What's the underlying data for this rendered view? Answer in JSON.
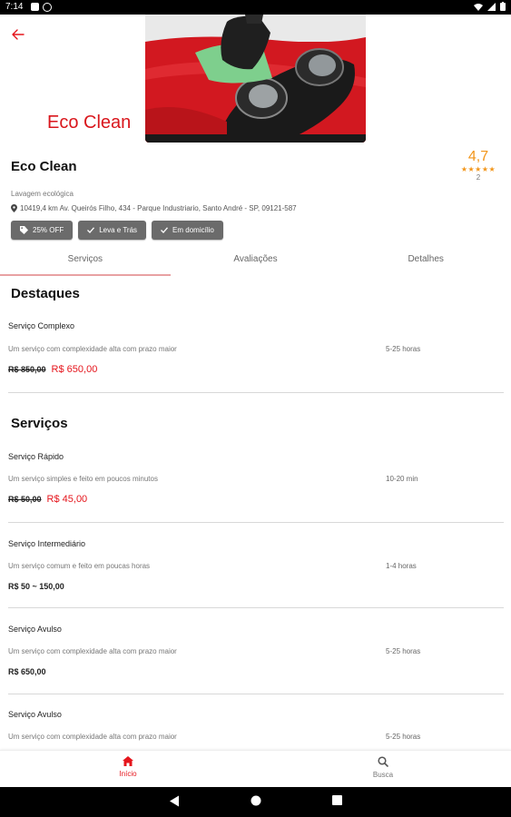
{
  "status_bar": {
    "time": "7:14"
  },
  "shop": {
    "hero_logo_text": "Eco Clean",
    "name": "Eco Clean",
    "rating": "4,7",
    "stars": "★★★★★",
    "review_count": "2",
    "category": "Lavagem ecológica",
    "address": "10419,4 km Av. Queirós Filho, 434 - Parque Industriario, Santo André - SP, 09121-587"
  },
  "badges": [
    {
      "label": "25% OFF",
      "icon": "tag-icon"
    },
    {
      "label": "Leva e Trás",
      "icon": "check-icon"
    },
    {
      "label": "Em domicílio",
      "icon": "check-icon"
    }
  ],
  "tabs": [
    {
      "label": "Serviços",
      "active": true
    },
    {
      "label": "Avaliações",
      "active": false
    },
    {
      "label": "Detalhes",
      "active": false
    }
  ],
  "highlights": {
    "title": "Destaques",
    "items": [
      {
        "name": "Serviço Complexo",
        "description": "Um serviço com complexidade alta com prazo maior",
        "duration": "5-25 horas",
        "old_price": "R$ 850,00",
        "price": "R$ 650,00"
      }
    ]
  },
  "services": {
    "title": "Serviços",
    "items": [
      {
        "name": "Serviço Rápido",
        "description": "Um serviço simples e feito em poucos minutos",
        "duration": "10-20 min",
        "old_price": "R$ 50,00",
        "price": "R$ 45,00"
      },
      {
        "name": "Serviço Intermediário",
        "description": "Um serviço comum e feito em poucas horas",
        "duration": "1-4 horas",
        "price": "R$ 50 ~ 150,00"
      },
      {
        "name": "Serviço Avulso",
        "description": "Um serviço com complexidade alta com prazo maior",
        "duration": "5-25 horas",
        "price": "R$ 650,00"
      },
      {
        "name": "Serviço Avulso",
        "description": "Um serviço com complexidade alta com prazo maior",
        "duration": "5-25 horas"
      }
    ]
  },
  "bottom_nav": [
    {
      "label": "Início",
      "icon": "home-icon",
      "active": true
    },
    {
      "label": "Busca",
      "icon": "search-icon",
      "active": false
    }
  ],
  "colors": {
    "accent": "#e5151c",
    "rating": "#f2961b",
    "badge": "#6b6b6b"
  }
}
